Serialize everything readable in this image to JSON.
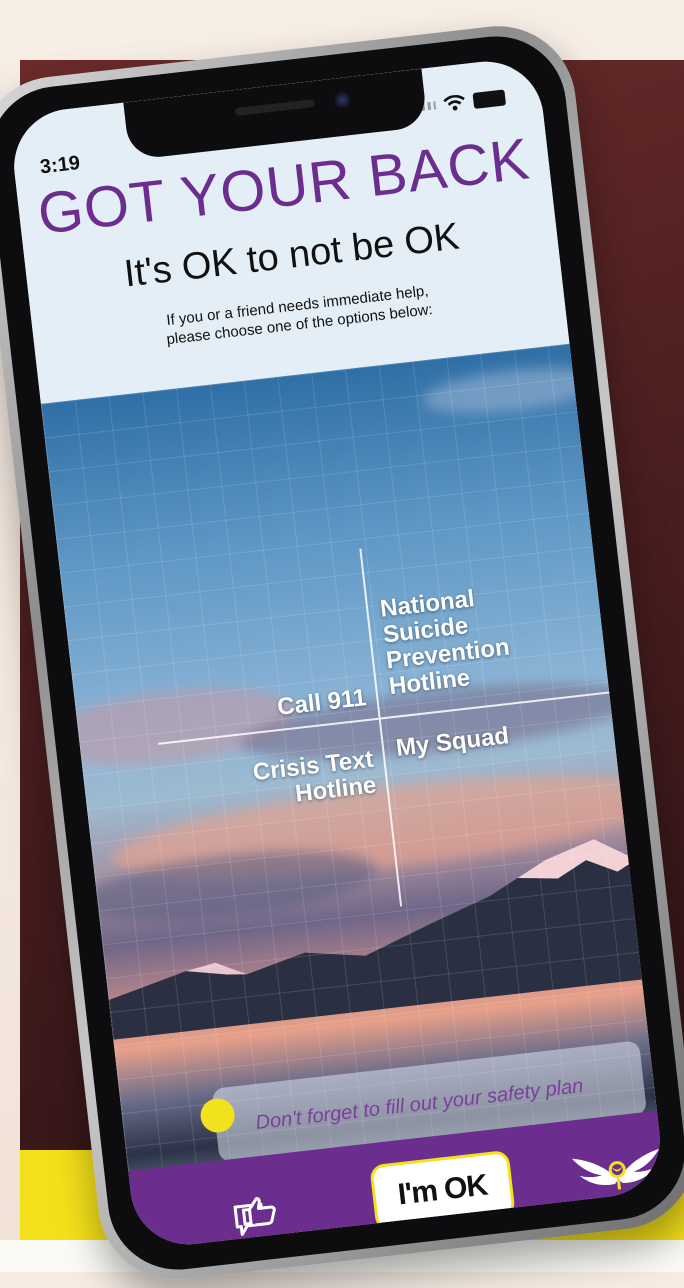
{
  "status_bar": {
    "time": "3:19"
  },
  "header": {
    "brand": "GOT YOUR BACK",
    "tagline": "It's OK to not be OK",
    "subtext_line1": "If you or a friend needs immediate help,",
    "subtext_line2": "please choose one of the options below:"
  },
  "options": {
    "call_911": "Call 911",
    "nsph_line1": "National",
    "nsph_line2": "Suicide",
    "nsph_line3": "Prevention",
    "nsph_line4": "Hotline",
    "crisis_line1": "Crisis Text",
    "crisis_line2": "Hotline",
    "my_squad": "My Squad"
  },
  "reminder": {
    "text": "Don't forget to fill out your safety plan"
  },
  "tab_bar": {
    "ok_button": "I'm OK",
    "left_icon": "thumbs-up-chat-icon",
    "right_icon": "wings-logo-icon"
  },
  "colors": {
    "brand_purple": "#6b2d8e",
    "accent_yellow": "#f2e21e",
    "header_bg": "#e4eef6"
  }
}
